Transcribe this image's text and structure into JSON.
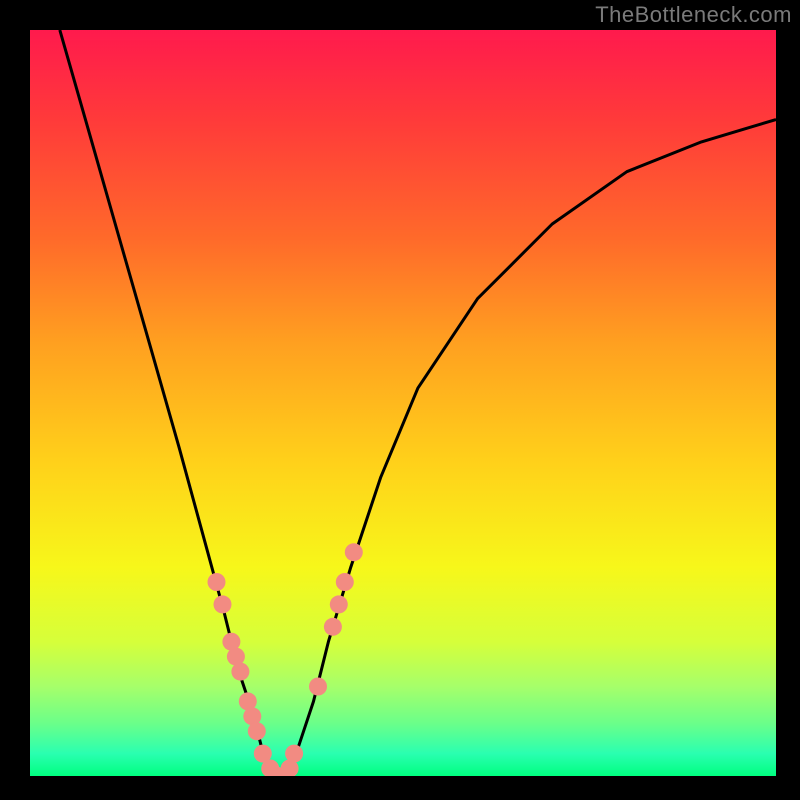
{
  "watermark": "TheBottleneck.com",
  "chart_data": {
    "type": "line",
    "title": "",
    "xlabel": "",
    "ylabel": "",
    "xlim": [
      0,
      100
    ],
    "ylim": [
      0,
      100
    ],
    "background_gradient_meaning": "red (top) = high bottleneck, green (bottom) = no bottleneck",
    "curve_description": "V-shaped bottleneck curve; minimum near x≈33 where bottleneck ≈ 0",
    "series": [
      {
        "name": "bottleneck-curve",
        "x": [
          4,
          8,
          12,
          16,
          20,
          23,
          26,
          28,
          30,
          31,
          32,
          33,
          34,
          35,
          36,
          38,
          40,
          43,
          47,
          52,
          60,
          70,
          80,
          90,
          100
        ],
        "y": [
          100,
          86,
          72,
          58,
          44,
          33,
          22,
          14,
          8,
          4,
          1,
          0,
          0,
          1,
          4,
          10,
          18,
          28,
          40,
          52,
          64,
          74,
          81,
          85,
          88
        ]
      }
    ],
    "markers": {
      "description": "salmon dots along the curve near the trough",
      "color": "#f28b82",
      "points": [
        {
          "x": 25.0,
          "y": 26
        },
        {
          "x": 25.8,
          "y": 23
        },
        {
          "x": 27.0,
          "y": 18
        },
        {
          "x": 27.6,
          "y": 16
        },
        {
          "x": 28.2,
          "y": 14
        },
        {
          "x": 29.2,
          "y": 10
        },
        {
          "x": 29.8,
          "y": 8
        },
        {
          "x": 30.4,
          "y": 6
        },
        {
          "x": 31.2,
          "y": 3
        },
        {
          "x": 32.2,
          "y": 1
        },
        {
          "x": 33.2,
          "y": 0
        },
        {
          "x": 34.8,
          "y": 1
        },
        {
          "x": 35.4,
          "y": 3
        },
        {
          "x": 38.6,
          "y": 12
        },
        {
          "x": 40.6,
          "y": 20
        },
        {
          "x": 41.4,
          "y": 23
        },
        {
          "x": 42.2,
          "y": 26
        },
        {
          "x": 43.4,
          "y": 30
        }
      ]
    }
  }
}
